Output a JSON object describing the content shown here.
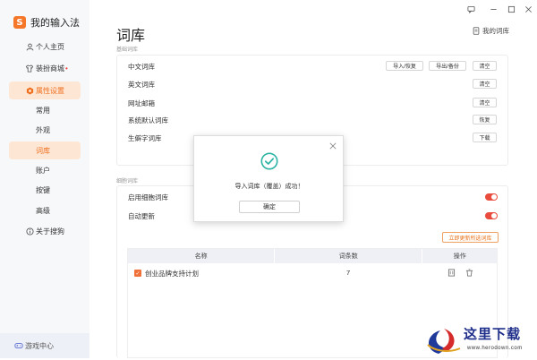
{
  "app": {
    "name": "我的输入法",
    "logo_glyph": "S"
  },
  "sidebar": {
    "items": [
      {
        "label": "个人主页",
        "icon": "user-icon"
      },
      {
        "label": "装扮商城",
        "icon": "tshirt-icon",
        "badge": "•"
      },
      {
        "label": "属性设置",
        "icon": "settings-hex-icon",
        "active": true
      },
      {
        "label": "关于搜狗",
        "icon": "info-icon"
      }
    ],
    "sub_items": [
      {
        "label": "常用"
      },
      {
        "label": "外观"
      },
      {
        "label": "词库",
        "active": true
      },
      {
        "label": "账户"
      },
      {
        "label": "按键"
      },
      {
        "label": "高级"
      }
    ],
    "game_center": "游戏中心"
  },
  "header": {
    "title": "词库",
    "my_lib_label": "我的词库"
  },
  "basic_section": {
    "label": "基础词库",
    "rows": [
      {
        "label": "中文词库",
        "buttons": [
          "导入/恢复",
          "导出/备份",
          "清空"
        ]
      },
      {
        "label": "英文词库",
        "buttons": [
          "清空"
        ]
      },
      {
        "label": "网址邮箱",
        "buttons": [
          "清空"
        ]
      },
      {
        "label": "系统默认词库",
        "buttons": [
          "恢复"
        ]
      },
      {
        "label": "生僻字词库",
        "buttons": [
          "下载"
        ]
      }
    ]
  },
  "cell_section": {
    "label": "细胞词库",
    "enable_label": "启用细胞词库",
    "auto_update_label": "自动更新",
    "update_button": "立即更新所选词库",
    "table": {
      "columns": [
        "名称",
        "词条数",
        "操作"
      ],
      "rows": [
        {
          "name": "创业品牌支持计划",
          "count": "7"
        }
      ]
    }
  },
  "modal": {
    "message": "导入词库（覆盖）成功！",
    "ok_label": "确定"
  },
  "watermark": {
    "text": "这里下载",
    "url": "www.herodown.com"
  },
  "colors": {
    "accent": "#f07020",
    "active_bg": "#fde6d4",
    "toggle_on": "#e94b3c",
    "success": "#2bb3a3"
  }
}
